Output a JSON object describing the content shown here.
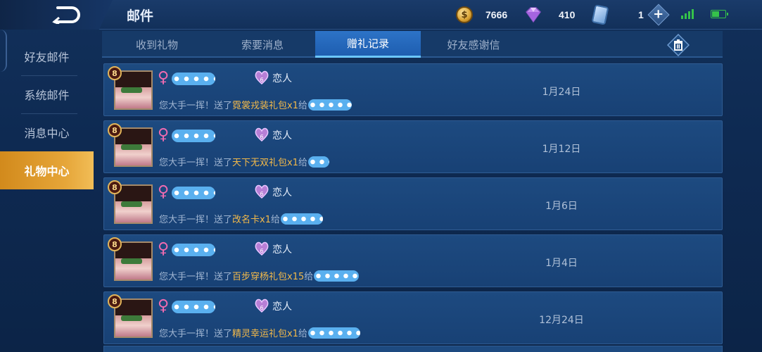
{
  "header": {
    "title": "邮件",
    "back_icon": "back-arrow-icon",
    "coins": "7666",
    "gems": "410",
    "coupons": "1"
  },
  "sidebar": {
    "items": [
      {
        "label": "好友邮件",
        "active": false
      },
      {
        "label": "系统邮件",
        "active": false
      },
      {
        "label": "消息中心",
        "active": false
      },
      {
        "label": "礼物中心",
        "active": true
      }
    ]
  },
  "tabs": [
    {
      "label": "收到礼物",
      "active": false
    },
    {
      "label": "索要消息",
      "active": false
    },
    {
      "label": "赠礼记录",
      "active": true
    },
    {
      "label": "好友感谢信",
      "active": false
    }
  ],
  "records": [
    {
      "level": "8",
      "relation_level": "6",
      "relation": "恋人",
      "date": "1月24日",
      "msg_prefix": "您大手一挥！送了",
      "gift": "霓裳戎装礼包x1",
      "msg_suffix": "给"
    },
    {
      "level": "8",
      "relation_level": "6",
      "relation": "恋人",
      "date": "1月12日",
      "msg_prefix": "您大手一挥！送了",
      "gift": "天下无双礼包x1",
      "msg_suffix": "给"
    },
    {
      "level": "8",
      "relation_level": "6",
      "relation": "恋人",
      "date": "1月6日",
      "msg_prefix": "您大手一挥！送了",
      "gift": "改名卡x1",
      "msg_suffix": "给"
    },
    {
      "level": "8",
      "relation_level": "6",
      "relation": "恋人",
      "date": "1月4日",
      "msg_prefix": "您大手一挥！送了",
      "gift": "百步穿杨礼包x15",
      "msg_suffix": "给"
    },
    {
      "level": "8",
      "relation_level": "6",
      "relation": "恋人",
      "date": "12月24日",
      "msg_prefix": "您大手一挥！送了",
      "gift": "精灵幸运礼包x1",
      "msg_suffix": "给"
    }
  ],
  "colors": {
    "accent_gold": "#f2b94a",
    "active_tab": "#1e5eb0",
    "active_sidebar": "#e6a639",
    "gender_female": "#f06bb0"
  }
}
